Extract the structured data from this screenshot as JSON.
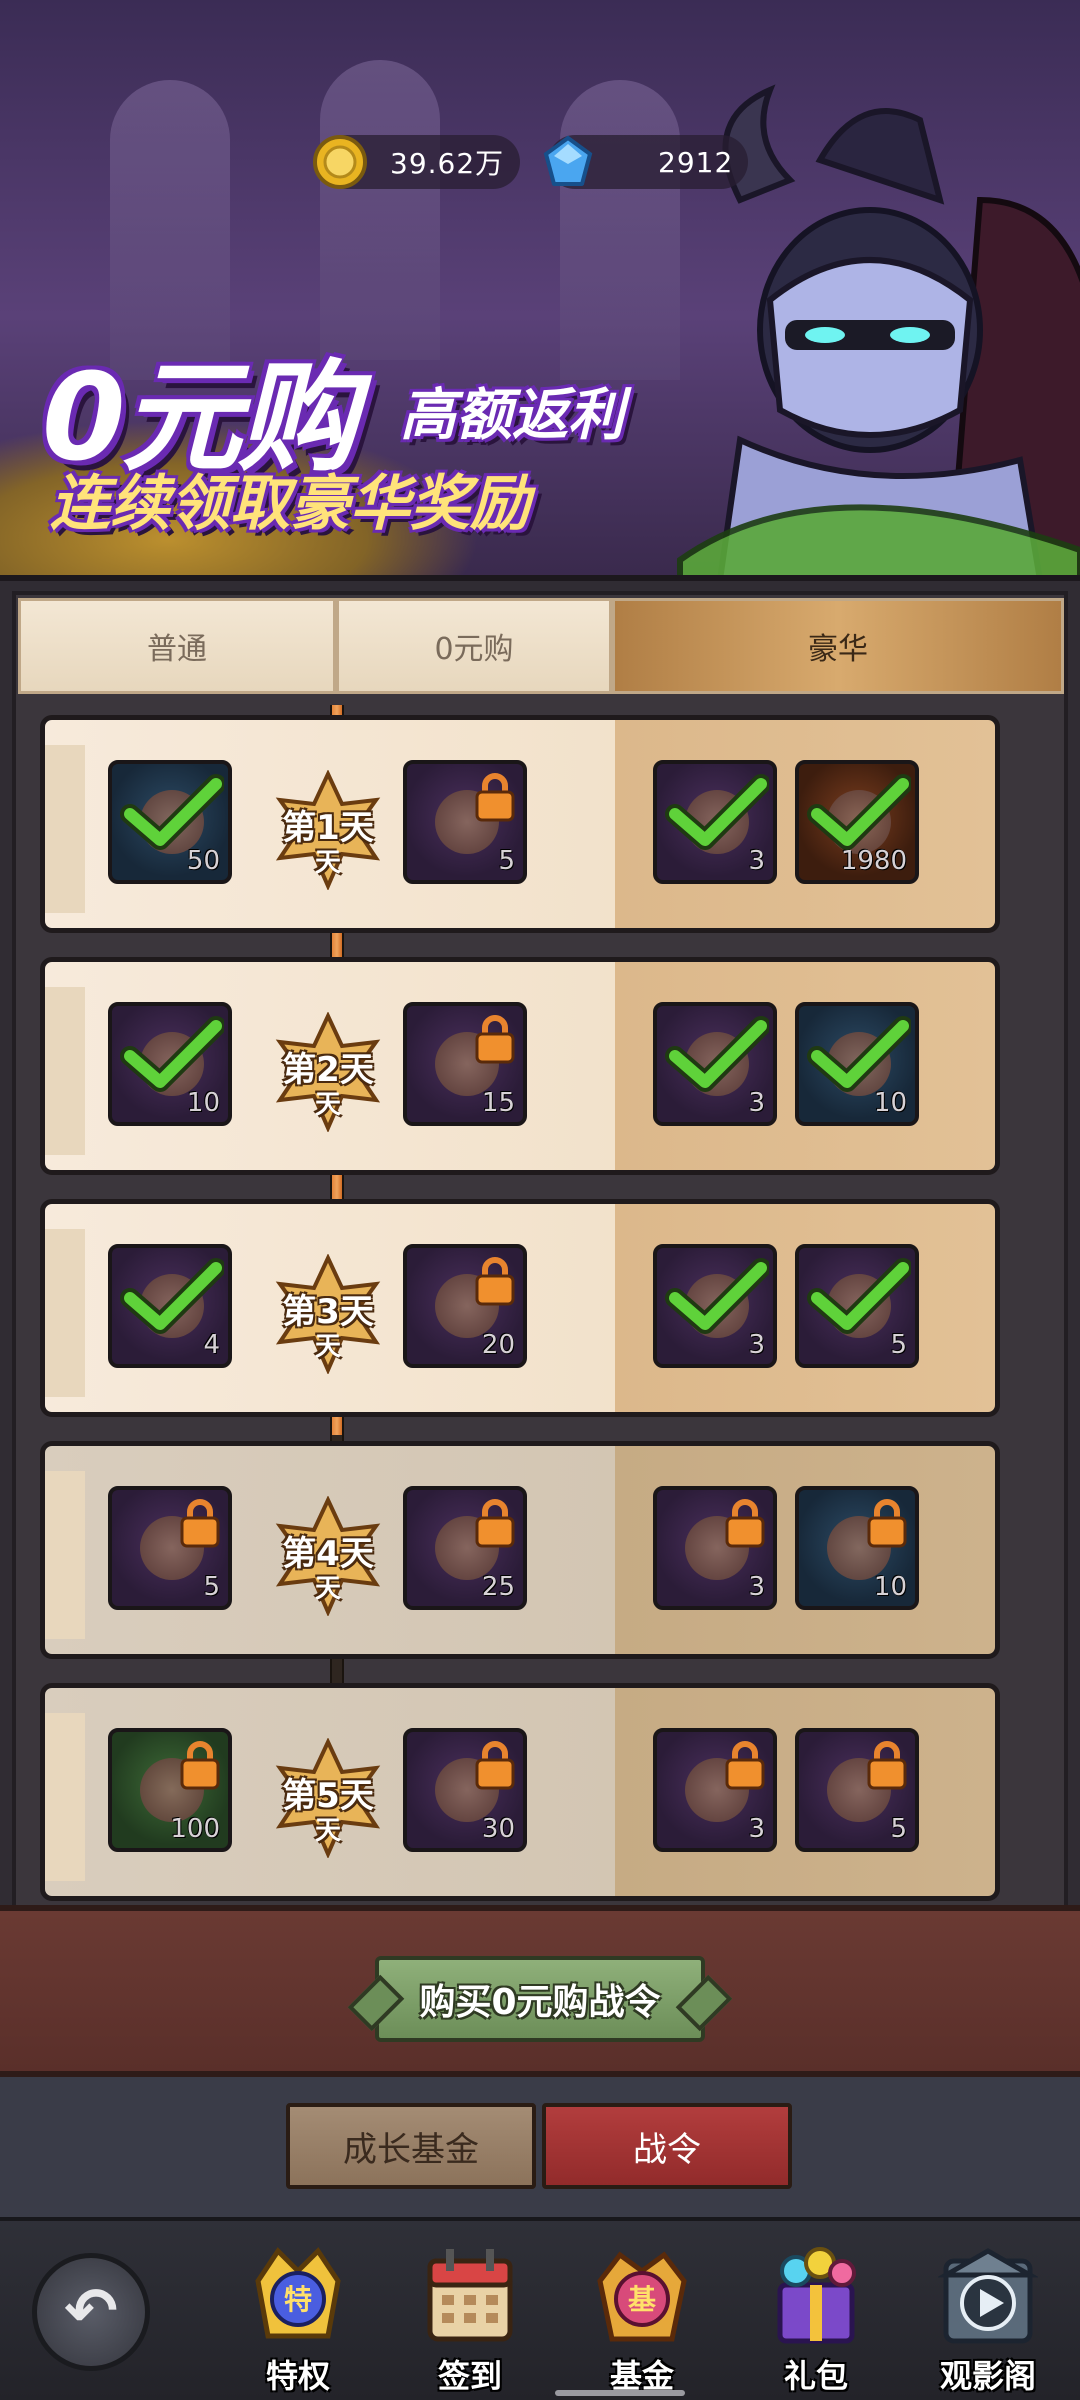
{
  "currency": {
    "gold": "39.62万",
    "gems": "2912"
  },
  "banner": {
    "title_big": "0元购",
    "title_sub": "高额返利",
    "title_sub2": "连续领取豪华奖励"
  },
  "tabs": [
    "普通",
    "0元购",
    "豪华"
  ],
  "rows": [
    {
      "day": "第1天",
      "day_sub": "天",
      "locked": false,
      "items": [
        {
          "qty": "50",
          "state": "claimed",
          "color": "blue"
        },
        {
          "qty": "5",
          "state": "locked",
          "color": "purple"
        },
        {
          "qty": "3",
          "state": "claimed",
          "color": "purple"
        },
        {
          "qty": "1980",
          "state": "claimed",
          "color": "orange"
        }
      ]
    },
    {
      "day": "第2天",
      "day_sub": "天",
      "locked": false,
      "items": [
        {
          "qty": "10",
          "state": "claimed",
          "color": "purple"
        },
        {
          "qty": "15",
          "state": "locked",
          "color": "purple"
        },
        {
          "qty": "3",
          "state": "claimed",
          "color": "purple"
        },
        {
          "qty": "10",
          "state": "claimed",
          "color": "blue"
        }
      ]
    },
    {
      "day": "第3天",
      "day_sub": "天",
      "locked": false,
      "items": [
        {
          "qty": "4",
          "state": "claimed",
          "color": "purple"
        },
        {
          "qty": "20",
          "state": "locked",
          "color": "purple"
        },
        {
          "qty": "3",
          "state": "claimed",
          "color": "purple"
        },
        {
          "qty": "5",
          "state": "claimed",
          "color": "purple"
        }
      ]
    },
    {
      "day": "第4天",
      "day_sub": "天",
      "locked": true,
      "items": [
        {
          "qty": "5",
          "state": "locked",
          "color": "purple"
        },
        {
          "qty": "25",
          "state": "locked",
          "color": "purple"
        },
        {
          "qty": "3",
          "state": "locked",
          "color": "purple"
        },
        {
          "qty": "10",
          "state": "locked",
          "color": "blue"
        }
      ]
    },
    {
      "day": "第5天",
      "day_sub": "天",
      "locked": true,
      "items": [
        {
          "qty": "100",
          "state": "locked",
          "color": "green"
        },
        {
          "qty": "30",
          "state": "locked",
          "color": "purple"
        },
        {
          "qty": "3",
          "state": "locked",
          "color": "purple"
        },
        {
          "qty": "5",
          "state": "locked",
          "color": "purple"
        }
      ]
    }
  ],
  "buy_button": "购买0元购战令",
  "subtabs": {
    "growth_fund": "成长基金",
    "battle_pass": "战令"
  },
  "nav": {
    "privilege": "特权",
    "checkin": "签到",
    "fund": "基金",
    "gift": "礼包",
    "theater": "观影阁",
    "privilege_icon_text": "特",
    "fund_icon_text": "基"
  }
}
